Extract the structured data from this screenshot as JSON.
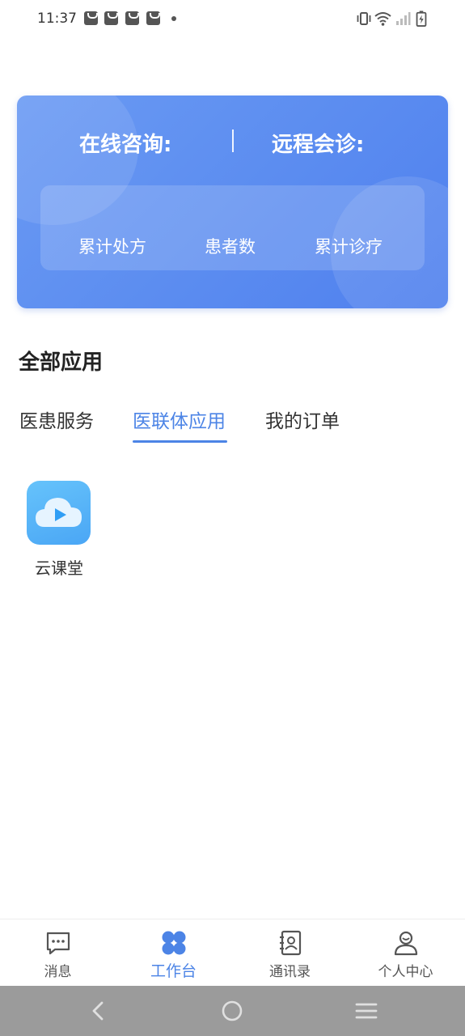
{
  "status_bar": {
    "time": "11:37",
    "notification_icons": [
      "shopping-bag-icon",
      "shopping-bag-icon",
      "shopping-bag-icon",
      "shopping-bag-icon"
    ],
    "system_icons": [
      "vibrate-icon",
      "wifi-icon",
      "signal-icon",
      "battery-charging-icon"
    ]
  },
  "summary": {
    "online_consult_label": "在线咨询:",
    "remote_consult_label": "远程会诊:",
    "stats": [
      {
        "label": "累计处方"
      },
      {
        "label": "患者数"
      },
      {
        "label": "累计诊疗"
      }
    ]
  },
  "section": {
    "title": "全部应用",
    "tabs": [
      {
        "label": "医患服务",
        "active": false
      },
      {
        "label": "医联体应用",
        "active": true
      },
      {
        "label": "我的订单",
        "active": false
      }
    ],
    "apps": [
      {
        "label": "云课堂",
        "icon": "cloud-play-icon"
      }
    ]
  },
  "bottom_nav": {
    "items": [
      {
        "label": "消息",
        "icon": "message-icon",
        "active": false
      },
      {
        "label": "工作台",
        "icon": "workbench-icon",
        "active": true
      },
      {
        "label": "通讯录",
        "icon": "contacts-icon",
        "active": false
      },
      {
        "label": "个人中心",
        "icon": "profile-icon",
        "active": false
      }
    ]
  },
  "system_nav": {
    "buttons": [
      "back-icon",
      "home-icon",
      "menu-icon"
    ]
  },
  "colors": {
    "accent": "#4c84e6",
    "card_gradient_start": "#6a9af3",
    "card_gradient_end": "#4f80ee",
    "app_icon": "#4aa6f5",
    "system_nav_bg": "#9b9b9b"
  }
}
